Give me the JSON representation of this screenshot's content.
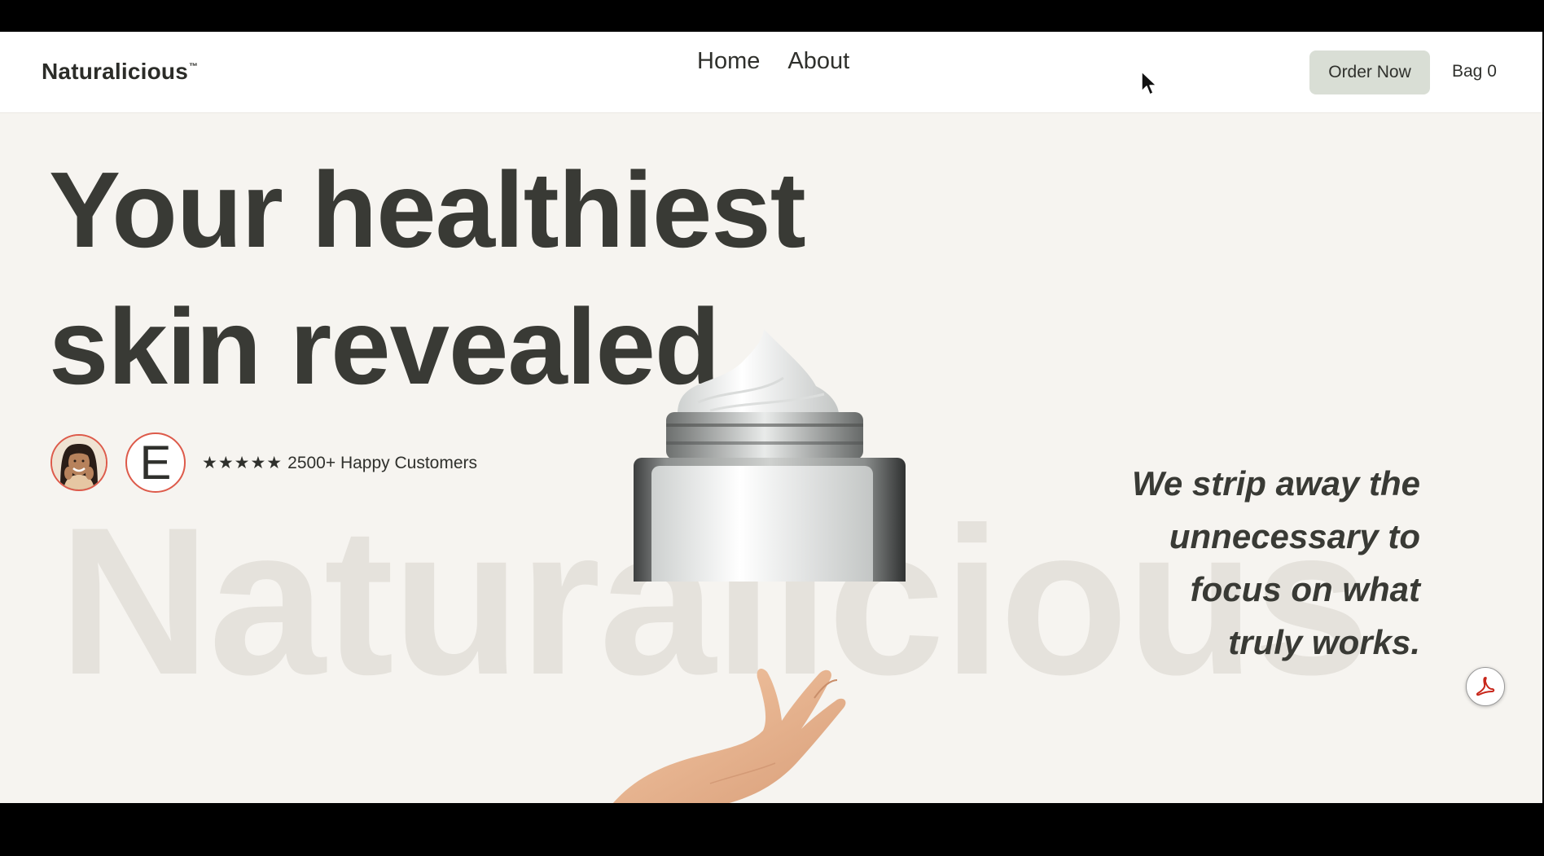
{
  "header": {
    "brand": "Naturalicious",
    "trademark": "™",
    "nav": [
      {
        "label": "Home"
      },
      {
        "label": "About"
      }
    ],
    "order_button": "Order Now",
    "bag": "Bag 0"
  },
  "hero": {
    "headline_line1": "Your healthiest",
    "headline_line2": "skin revealed",
    "watermark": "Naturalicious",
    "avatar_letter": "E",
    "rating_stars": "★★★★★",
    "rating_text": "2500+ Happy Customers",
    "tagline": [
      "We strip away the",
      "unnecessary to",
      "focus on what",
      "truly works."
    ]
  },
  "colors": {
    "background": "#f6f4f0",
    "header": "#ffffff",
    "text": "#393a35",
    "button": "#d9ded5",
    "watermark": "#e5e2dc",
    "avatar_ring": "#dd5a4a",
    "pdf_red": "#c8271b"
  },
  "icons": {
    "cursor": "arrow-cursor-icon",
    "pdf": "pdf-icon"
  }
}
